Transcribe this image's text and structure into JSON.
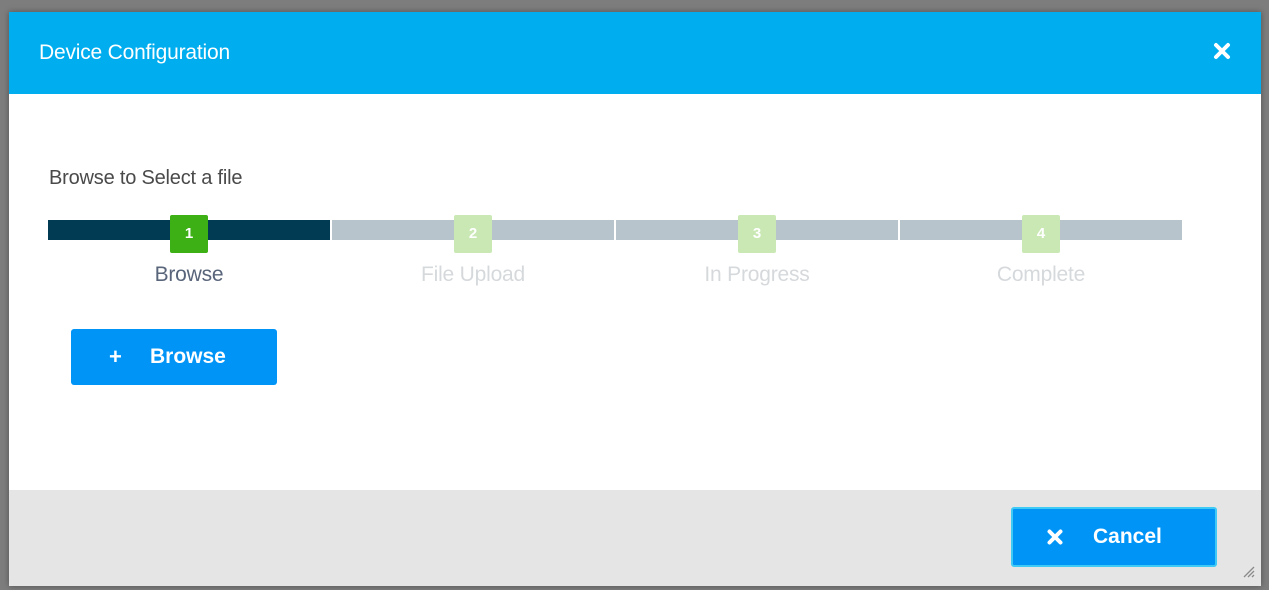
{
  "dialog": {
    "title": "Device Configuration",
    "close_icon": "close-icon",
    "header_color": "#00aeef"
  },
  "instruction": "Browse to Select a file",
  "steps": [
    {
      "number": "1",
      "label": "Browse",
      "state": "active"
    },
    {
      "number": "2",
      "label": "File Upload",
      "state": "pending"
    },
    {
      "number": "3",
      "label": "In Progress",
      "state": "pending"
    },
    {
      "number": "4",
      "label": "Complete",
      "state": "pending"
    }
  ],
  "browse_button": {
    "icon": "plus-icon",
    "label": "Browse"
  },
  "footer": {
    "cancel_button": {
      "icon": "close-icon",
      "label": "Cancel"
    },
    "resize_icon": "resize-grip-icon"
  },
  "colors": {
    "accent": "#00aeef",
    "button": "#0094f7",
    "step_active": "#3cb015",
    "step_pending": "#c9e8b4",
    "bar_active": "#003a53",
    "bar_pending": "#b8c4cb"
  }
}
